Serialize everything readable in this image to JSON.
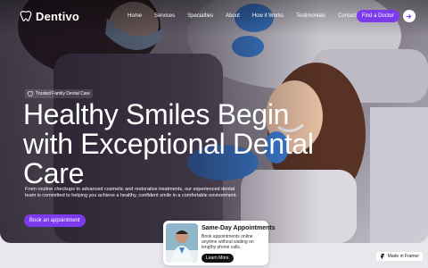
{
  "nav": {
    "logo_text": "Dentivo",
    "items": [
      "Home",
      "Services",
      "Specialties",
      "About",
      "How it Works",
      "Testimonials",
      "Contact"
    ],
    "cta_label": "Find a Doctor"
  },
  "hero": {
    "badge": "Trusted Family Dental Care",
    "headline_lines": [
      "Healthy Smiles Begin",
      "with Exceptional Dental",
      "Care"
    ],
    "description": "From routine checkups to advanced cosmetic and restorative treatments, our experienced dental team is committed to helping you achieve a healthy, confident smile in a comfortable environment.",
    "button_label": "Book an appointment"
  },
  "card": {
    "title": "Same-Day Appointments",
    "text": "Book appointments online anytime without waiting on lengthy phone calls.",
    "button_label": "Learn More"
  },
  "framer_badge": "Made in Framer",
  "colors": {
    "accent": "#7c3aed",
    "text_on_dark": "#ffffff",
    "card_bg": "#ffffff"
  },
  "icons": {
    "logo": "tooth-icon",
    "badge": "shield-icon",
    "cta_arrow": "arrow-right-icon",
    "framer": "framer-logo-icon"
  }
}
